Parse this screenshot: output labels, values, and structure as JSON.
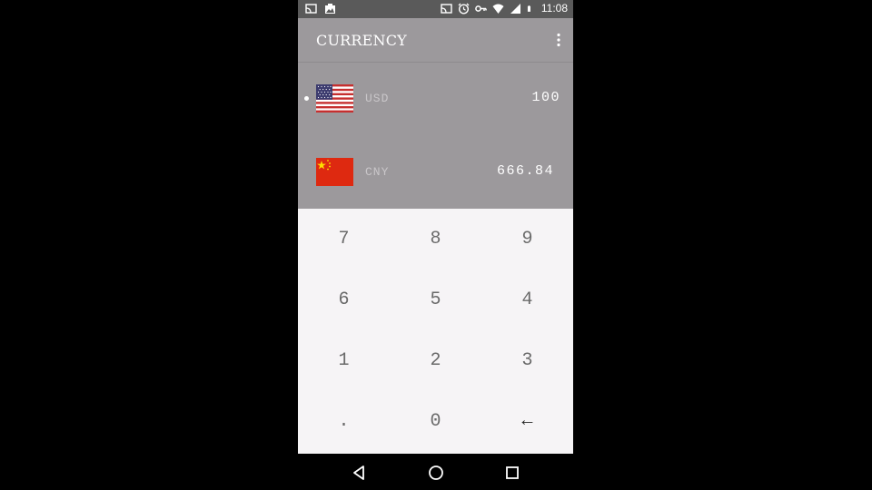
{
  "status_bar": {
    "time": "11:08",
    "left_icons": [
      "cast-icon",
      "photo-icon"
    ],
    "right_icons": [
      "cast-icon",
      "alarm-icon",
      "key-icon",
      "wifi-icon",
      "signal-icon",
      "battery-icon"
    ]
  },
  "app_bar": {
    "title": "CURRENCY",
    "menu_icon": "more-vert-icon"
  },
  "currencies": [
    {
      "code": "USD",
      "value": "100",
      "flag": "us-flag",
      "selected": true
    },
    {
      "code": "CNY",
      "value": "666.84",
      "flag": "cn-flag",
      "selected": false
    }
  ],
  "keypad": {
    "keys": [
      "7",
      "8",
      "9",
      "6",
      "5",
      "4",
      "1",
      "2",
      "3",
      ".",
      "0",
      "←"
    ]
  },
  "nav_bar": {
    "buttons": [
      "back-icon",
      "home-icon",
      "recents-icon"
    ]
  },
  "colors": {
    "header_bg": "#9c999c",
    "keypad_bg": "#f6f4f6",
    "status_bg": "#5a5a5a"
  }
}
